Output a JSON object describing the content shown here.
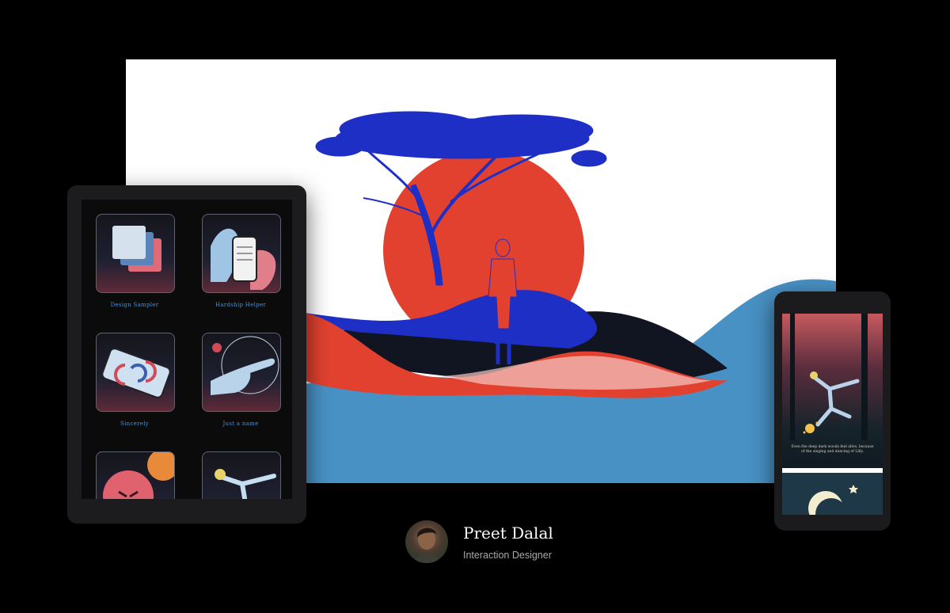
{
  "tablet": {
    "projects": [
      {
        "label": "Design Sampler"
      },
      {
        "label": "Hardship Helper"
      },
      {
        "label": "Sincerely"
      },
      {
        "label": "Just a name"
      },
      {
        "label": ""
      },
      {
        "label": ""
      }
    ]
  },
  "phone": {
    "caption": "Even the deep dark woods feel alive, because of the singing and dancing of Lilly."
  },
  "profile": {
    "name": "Preet Dalal",
    "role": "Interaction Designer"
  },
  "colors": {
    "background": "#000000",
    "sun": "#e2412f",
    "tree": "#1e2fc6",
    "water": "#4891c4",
    "label_blue": "#4b8fd0"
  }
}
